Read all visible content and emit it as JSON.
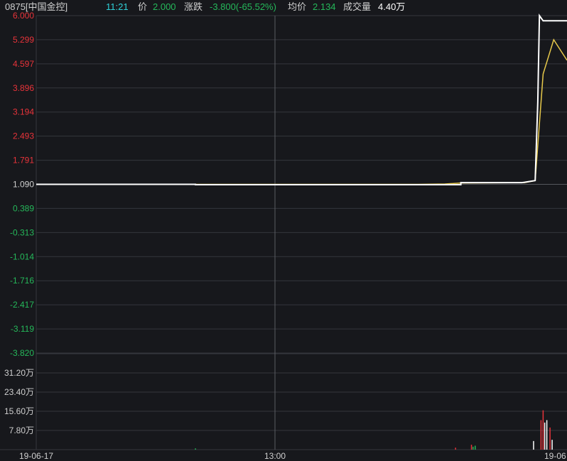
{
  "header": {
    "code_name": "0875[中国金控]",
    "time": "11:21",
    "price_label": "价",
    "price_value": "2.000",
    "change_label": "涨跌",
    "change_value": "-3.800(-65.52%)",
    "avg_label": "均价",
    "avg_value": "2.134",
    "volume_label": "成交量",
    "volume_value": "4.40万"
  },
  "colors": {
    "background": "#17181c",
    "grid": "#34363c",
    "up": "#e8333a",
    "down": "#25b85a",
    "price_line": "#ffffff",
    "avg_line": "#e6c84a",
    "text": "#cfcfcf",
    "time_cyan": "#2fd0d8"
  },
  "chart_data": [
    {
      "type": "line",
      "title": "",
      "y_ticks": [
        "6.000",
        "5.299",
        "4.597",
        "3.896",
        "3.194",
        "2.493",
        "1.791",
        "1.090",
        "0.389",
        "-0.313",
        "-1.014",
        "-1.716",
        "-2.417",
        "-3.119",
        "-3.820"
      ],
      "ylim": [
        -3.82,
        6.0
      ],
      "reference_price": 1.09,
      "x_labels": [
        "19-06-17",
        "13:00",
        "19-06"
      ],
      "series": [
        {
          "points": [
            [
              0,
              1.09
            ],
            [
              0.3,
              1.09
            ],
            [
              0.3,
              1.08
            ],
            [
              0.8,
              1.08
            ],
            [
              0.8,
              1.14
            ],
            [
              0.915,
              1.14
            ],
            [
              0.92,
              1.15
            ],
            [
              0.94,
              1.2
            ],
            [
              0.945,
              3.5
            ],
            [
              0.948,
              6.0
            ],
            [
              0.955,
              5.85
            ],
            [
              1.0,
              5.85
            ]
          ]
        },
        {
          "points": [
            [
              0,
              1.09
            ],
            [
              0.72,
              1.09
            ],
            [
              0.77,
              1.1
            ],
            [
              0.8,
              1.13
            ],
            [
              0.92,
              1.14
            ],
            [
              0.94,
              1.2
            ],
            [
              0.955,
              4.3
            ],
            [
              0.975,
              5.3
            ],
            [
              1.0,
              4.7
            ]
          ]
        }
      ]
    },
    {
      "type": "bar",
      "title": "",
      "y_ticks": [
        "31.20万",
        "23.40万",
        "15.60万",
        "7.80万"
      ],
      "ylim": [
        0,
        39.0
      ],
      "unit": "万",
      "bars": [
        {
          "x": 0.3,
          "value": 0.5,
          "dir": "down"
        },
        {
          "x": 0.79,
          "value": 0.8,
          "dir": "up"
        },
        {
          "x": 0.82,
          "value": 2.0,
          "dir": "up"
        },
        {
          "x": 0.823,
          "value": 1.2,
          "dir": "down"
        },
        {
          "x": 0.827,
          "value": 1.6,
          "dir": "down"
        },
        {
          "x": 0.937,
          "value": 3.5,
          "dir": "flat"
        },
        {
          "x": 0.951,
          "value": 12.0,
          "dir": "up"
        },
        {
          "x": 0.955,
          "value": 16.0,
          "dir": "up"
        },
        {
          "x": 0.958,
          "value": 11.0,
          "dir": "flat"
        },
        {
          "x": 0.962,
          "value": 12.0,
          "dir": "flat"
        },
        {
          "x": 0.968,
          "value": 9.0,
          "dir": "up"
        },
        {
          "x": 0.972,
          "value": 4.0,
          "dir": "flat"
        }
      ]
    }
  ]
}
